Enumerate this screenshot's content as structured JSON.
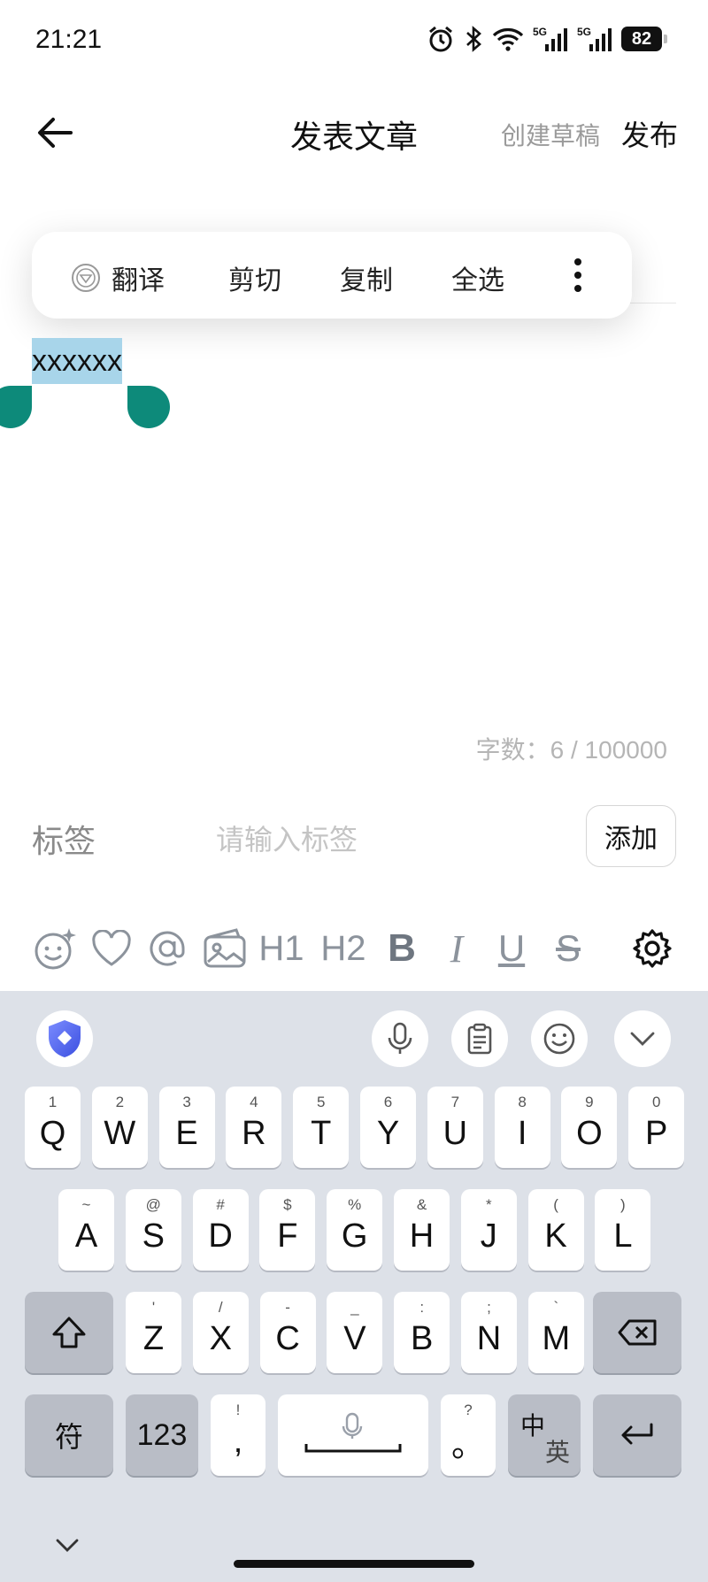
{
  "status_bar": {
    "time": "21:21",
    "battery": "82",
    "signal_label": "5G"
  },
  "header": {
    "title": "发表文章",
    "draft_label": "创建草稿",
    "publish_label": "发布"
  },
  "context_menu": {
    "translate": "翻译",
    "cut": "剪切",
    "copy": "复制",
    "select_all": "全选"
  },
  "editor": {
    "selected_text": "xxxxxx",
    "word_count": "字数：6 / 100000"
  },
  "tags": {
    "label": "标签",
    "placeholder": "请输入标签",
    "add_label": "添加"
  },
  "toolbar": {
    "h1": "H1",
    "h2": "H2",
    "bold": "B",
    "italic": "I",
    "underline": "U",
    "strike": "S"
  },
  "keyboard": {
    "row1": [
      {
        "hint": "1",
        "key": "Q"
      },
      {
        "hint": "2",
        "key": "W"
      },
      {
        "hint": "3",
        "key": "E"
      },
      {
        "hint": "4",
        "key": "R"
      },
      {
        "hint": "5",
        "key": "T"
      },
      {
        "hint": "6",
        "key": "Y"
      },
      {
        "hint": "7",
        "key": "U"
      },
      {
        "hint": "8",
        "key": "I"
      },
      {
        "hint": "9",
        "key": "O"
      },
      {
        "hint": "0",
        "key": "P"
      }
    ],
    "row2": [
      {
        "hint": "~",
        "key": "A"
      },
      {
        "hint": "@",
        "key": "S"
      },
      {
        "hint": "#",
        "key": "D"
      },
      {
        "hint": "$",
        "key": "F"
      },
      {
        "hint": "%",
        "key": "G"
      },
      {
        "hint": "&",
        "key": "H"
      },
      {
        "hint": "*",
        "key": "J"
      },
      {
        "hint": "(",
        "key": "K"
      },
      {
        "hint": ")",
        "key": "L"
      }
    ],
    "row3": [
      {
        "hint": "'",
        "key": "Z"
      },
      {
        "hint": "/",
        "key": "X"
      },
      {
        "hint": "-",
        "key": "C"
      },
      {
        "hint": "_",
        "key": "V"
      },
      {
        "hint": ":",
        "key": "B"
      },
      {
        "hint": ";",
        "key": "N"
      },
      {
        "hint": "`",
        "key": "M"
      }
    ],
    "symbols_label": "符",
    "numbers_label": "123",
    "comma": {
      "hint": "!",
      "key": ","
    },
    "period": {
      "hint": "?",
      "key": "。"
    },
    "lang_switch": {
      "primary": "中",
      "secondary": "英"
    }
  }
}
